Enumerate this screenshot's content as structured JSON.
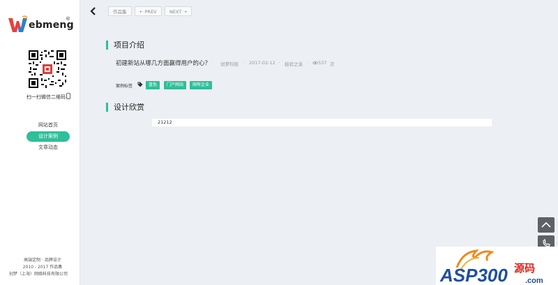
{
  "sidebar": {
    "logo_text": "ebmeng",
    "logo_reg": "®",
    "qr_caption": "扫一扫微信二维码",
    "nav": [
      {
        "label": "网站首页",
        "active": false
      },
      {
        "label": "设计案例",
        "active": true
      },
      {
        "label": "文章动态",
        "active": false
      }
    ],
    "footer": [
      "高端定制 · 品牌设计",
      "2010 - 2017 作品集",
      "创梦（上海）网络科技有限公司"
    ]
  },
  "topbar": {
    "portfolio_label": "作品集",
    "prev_label": "PREV",
    "next_label": "NEXT"
  },
  "intro": {
    "heading": "项目介绍",
    "article_title": "初建新站从哪几方面赢得用户的心？",
    "author": "创梦科技",
    "date": "2017-02-12",
    "category": "经验之谈",
    "views": "537",
    "views_unit": "次",
    "tags_label": "案例标签",
    "tags": [
      "蓝色",
      "门户网站",
      "国有企业"
    ]
  },
  "design": {
    "heading": "设计欣赏",
    "content": "21212"
  },
  "watermark": {
    "brand": "ASP300",
    "brand_cn": "源码",
    "domain": ".com"
  },
  "colors": {
    "accent": "#2fbf9a",
    "background": "#eceff3"
  }
}
